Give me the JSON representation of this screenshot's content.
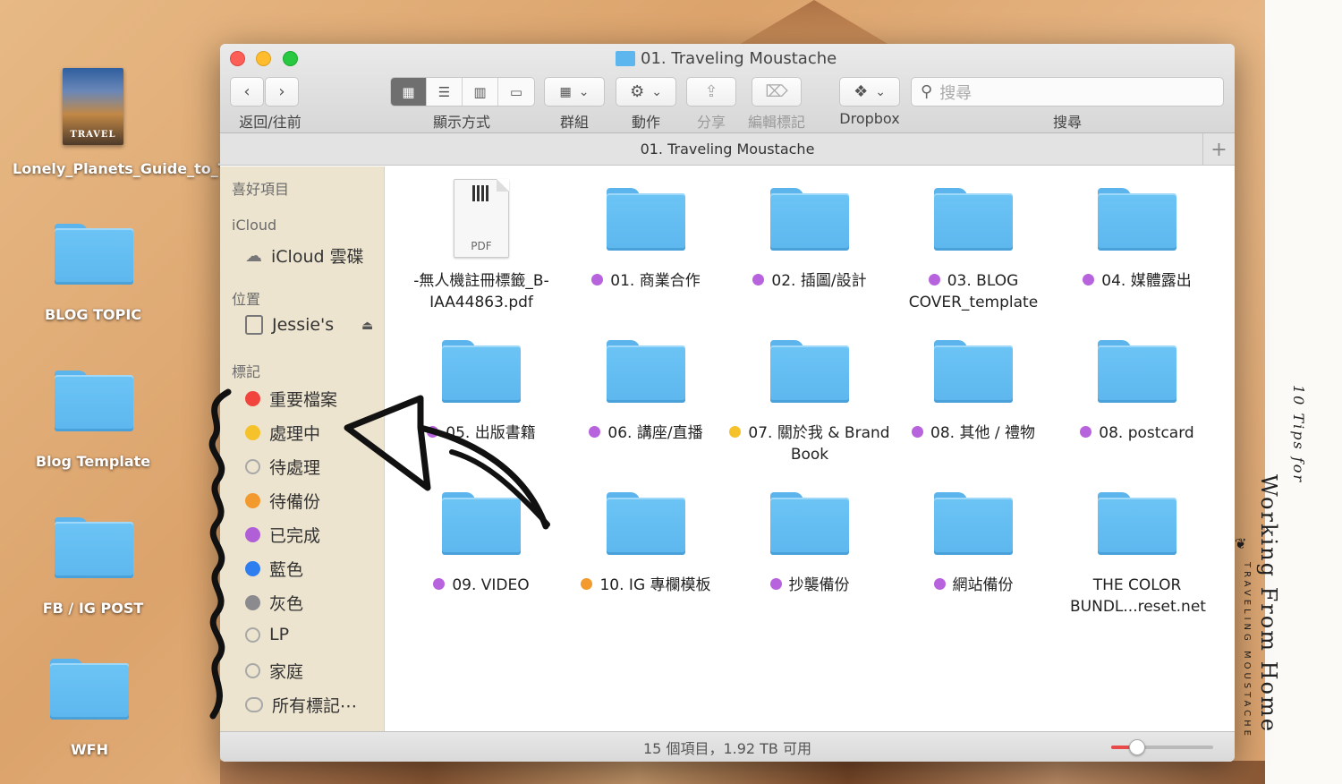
{
  "desktop": {
    "icons": [
      {
        "label": "Lonely_Planets_Guide_to_Tr...ition.epub",
        "cover_text": "TRAVEL"
      },
      {
        "label": "BLOG TOPIC"
      },
      {
        "label": "Blog Template"
      },
      {
        "label": "FB / IG POST"
      },
      {
        "label": "WFH"
      }
    ]
  },
  "poster": {
    "script": "10 Tips for",
    "title": "Working From Home",
    "brand": "TRAVELING MOUSTACHE"
  },
  "window": {
    "title": "01. Traveling Moustache",
    "toolbar": {
      "nav_label": "返回/往前",
      "view_label": "顯示方式",
      "group_label": "群組",
      "action_label": "動作",
      "share_label": "分享",
      "tags_label": "編輯標記",
      "dropbox_label": "Dropbox",
      "search_label": "搜尋",
      "search_placeholder": "搜尋"
    },
    "path": "01. Traveling Moustache",
    "sidebar": {
      "favorites_header": "喜好項目",
      "icloud_header": "iCloud",
      "icloud_item": "iCloud 雲碟",
      "locations_header": "位置",
      "location_item": "Jessie's",
      "tags_header": "標記",
      "tags": [
        {
          "label": "重要檔案",
          "color": "#f0443c"
        },
        {
          "label": "處理中",
          "color": "#f6c22c"
        },
        {
          "label": "待處理",
          "color": ""
        },
        {
          "label": "待備份",
          "color": "#f29a2e"
        },
        {
          "label": "已完成",
          "color": "#b05fd6"
        },
        {
          "label": "藍色",
          "color": "#2f7ef0"
        },
        {
          "label": "灰色",
          "color": "#8b8b8f"
        },
        {
          "label": "LP",
          "color": ""
        },
        {
          "label": "家庭",
          "color": ""
        },
        {
          "label": "所有標記⋯",
          "color": ""
        }
      ]
    },
    "items": [
      {
        "name": "-無人機註冊標籤_B-IAA44863.pdf",
        "type": "pdf",
        "tag": "",
        "pdf_label": "PDF"
      },
      {
        "name": "01. 商業合作",
        "type": "folder",
        "tag": "#b763dd"
      },
      {
        "name": "02. 插圖/設計",
        "type": "folder",
        "tag": "#b763dd"
      },
      {
        "name": "03. BLOG COVER_template",
        "type": "folder",
        "tag": "#b763dd"
      },
      {
        "name": "04. 媒體露出",
        "type": "folder",
        "tag": "#b763dd"
      },
      {
        "name": "05. 出版書籍",
        "type": "folder",
        "tag": "#b763dd"
      },
      {
        "name": "06. 講座/直播",
        "type": "folder",
        "tag": "#b763dd"
      },
      {
        "name": "07. 關於我 & Brand Book",
        "type": "folder",
        "tag": "#f6c22c"
      },
      {
        "name": "08. 其他 / 禮物",
        "type": "folder",
        "tag": "#b763dd"
      },
      {
        "name": "08. postcard",
        "type": "folder",
        "tag": "#b763dd"
      },
      {
        "name": "09. VIDEO",
        "type": "folder",
        "tag": "#b763dd"
      },
      {
        "name": "10. IG 專欄模板",
        "type": "folder",
        "tag": "#f29a2e"
      },
      {
        "name": "抄襲備份",
        "type": "folder",
        "tag": "#b763dd"
      },
      {
        "name": "網站備份",
        "type": "folder",
        "tag": "#b763dd"
      },
      {
        "name": "THE COLOR BUNDL...reset.net",
        "type": "folder",
        "tag": ""
      }
    ],
    "status": "15 個項目，1.92 TB 可用",
    "icon_size_fraction": 0.25
  }
}
